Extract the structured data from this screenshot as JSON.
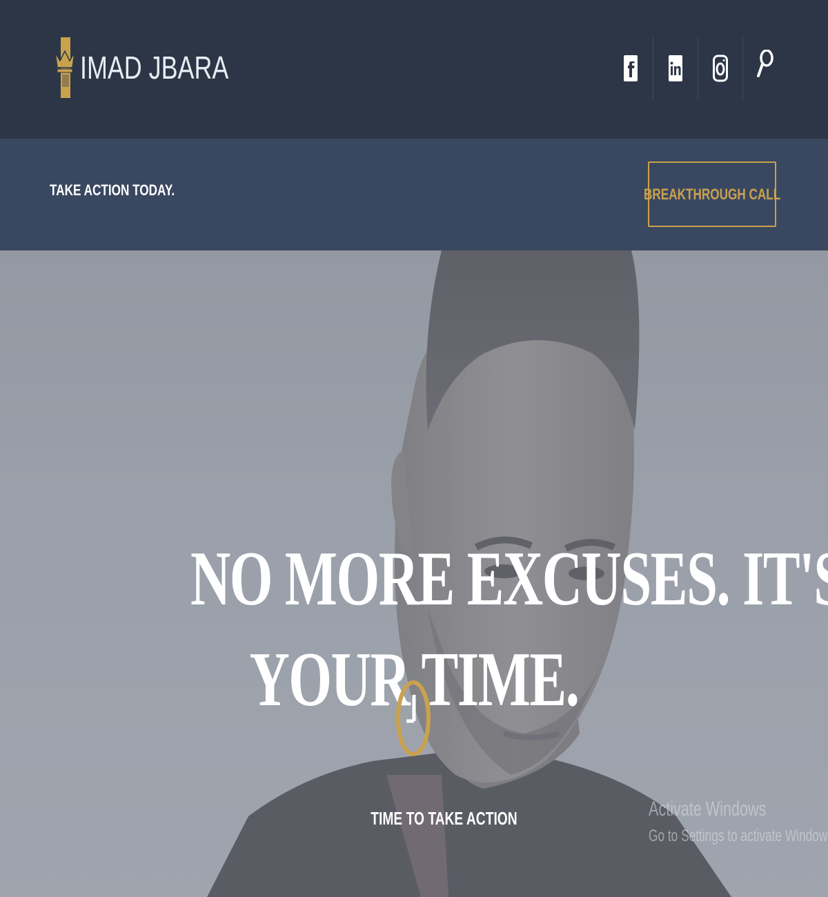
{
  "brand": {
    "name": "IMAD JBARA",
    "accent": "#c9a24e"
  },
  "header": {
    "social": [
      {
        "icon": "facebook-icon"
      },
      {
        "icon": "linkedin-icon"
      },
      {
        "icon": "instagram-icon"
      },
      {
        "icon": "search-icon"
      }
    ],
    "background": "#2c3647"
  },
  "subbar": {
    "tagline": "TAKE ACTION TODAY.",
    "cta_label": "BREAKTHROUGH CALL",
    "background": "#3a4760"
  },
  "hero": {
    "headline_line1": "NO MORE EXCUSES. IT'S",
    "headline_line2": "YOUR TIME.",
    "icon": "clock-icon",
    "cta_label": "TIME TO TAKE ACTION"
  },
  "watermark": {
    "line1": "Activate Windows",
    "line2": "Go to Settings to activate Windows."
  }
}
